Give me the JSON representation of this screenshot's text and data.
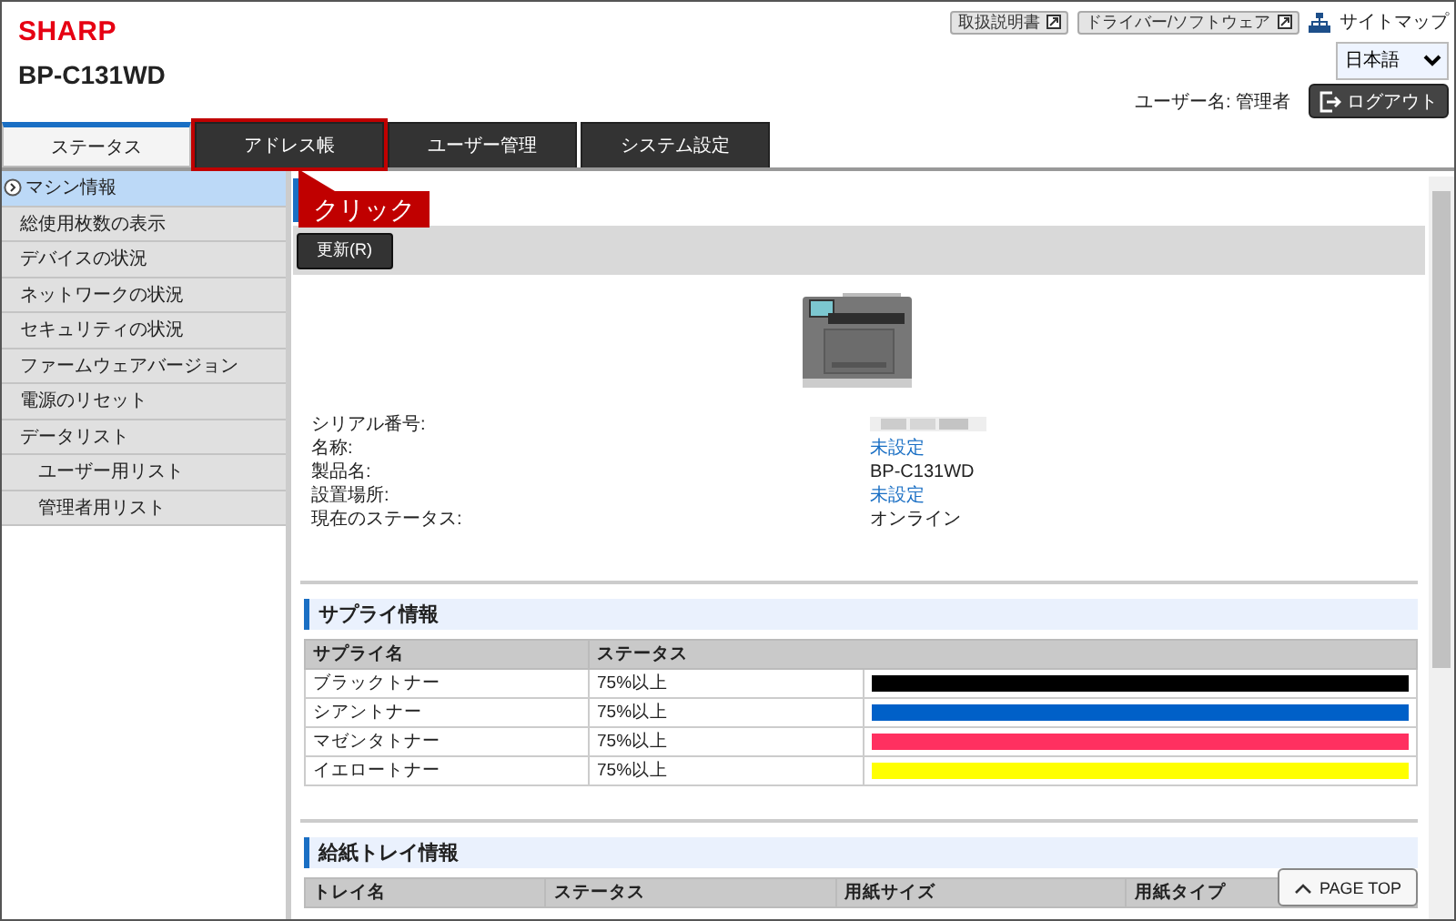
{
  "header": {
    "brand": "SHARP",
    "model": "BP-C131WD",
    "links": [
      {
        "label": "取扱説明書"
      },
      {
        "label": "ドライバー/ソフトウェア"
      }
    ],
    "sitemap": "サイトマップ",
    "language": "日本語",
    "user_name": "ユーザー名: 管理者",
    "logout": "ログアウト"
  },
  "tabs": [
    {
      "label": "ステータス",
      "selected": true,
      "highlighted": false
    },
    {
      "label": "アドレス帳",
      "selected": false,
      "highlighted": true
    },
    {
      "label": "ユーザー管理",
      "selected": false,
      "highlighted": false
    },
    {
      "label": "システム設定",
      "selected": false,
      "highlighted": false
    }
  ],
  "annotation": {
    "label": "クリック"
  },
  "sidebar": {
    "items": [
      {
        "label": "マシン情報",
        "selected": true
      },
      {
        "label": "総使用枚数の表示",
        "selected": false
      },
      {
        "label": "デバイスの状況",
        "selected": false
      },
      {
        "label": "ネットワークの状況",
        "selected": false
      },
      {
        "label": "セキュリティの状況",
        "selected": false
      },
      {
        "label": "ファームウェアバージョン",
        "selected": false
      },
      {
        "label": "電源のリセット",
        "selected": false
      },
      {
        "label": "データリスト",
        "selected": false,
        "children": [
          {
            "label": "ユーザー用リスト",
            "selected": false
          },
          {
            "label": "管理者用リスト",
            "selected": false
          }
        ]
      }
    ]
  },
  "toolbar": {
    "refresh": "更新(R)"
  },
  "machine_info": [
    {
      "label": "シリアル番号:",
      "kind": "redacted"
    },
    {
      "label": "名称:",
      "kind": "link",
      "value": "未設定"
    },
    {
      "label": "製品名:",
      "kind": "text",
      "value": "BP-C131WD"
    },
    {
      "label": "設置場所:",
      "kind": "link",
      "value": "未設定"
    },
    {
      "label": "現在のステータス:",
      "kind": "text",
      "value": "オンライン"
    }
  ],
  "supply": {
    "title": "サプライ情報",
    "columns": [
      "サプライ名",
      "ステータス"
    ],
    "rows": [
      {
        "name": "ブラックトナー",
        "status": "75%以上",
        "color": "#000000",
        "level": 1
      },
      {
        "name": "シアントナー",
        "status": "75%以上",
        "color": "#0060c8",
        "level": 1
      },
      {
        "name": "マゼンタトナー",
        "status": "75%以上",
        "color": "#ff3060",
        "level": 1
      },
      {
        "name": "イエロートナー",
        "status": "75%以上",
        "color": "#ffff00",
        "level": 1
      }
    ]
  },
  "trays": {
    "title": "給紙トレイ情報",
    "columns": [
      "トレイ名",
      "ステータス",
      "用紙サイズ",
      "用紙タイプ"
    ]
  },
  "page_top": "PAGE TOP"
}
